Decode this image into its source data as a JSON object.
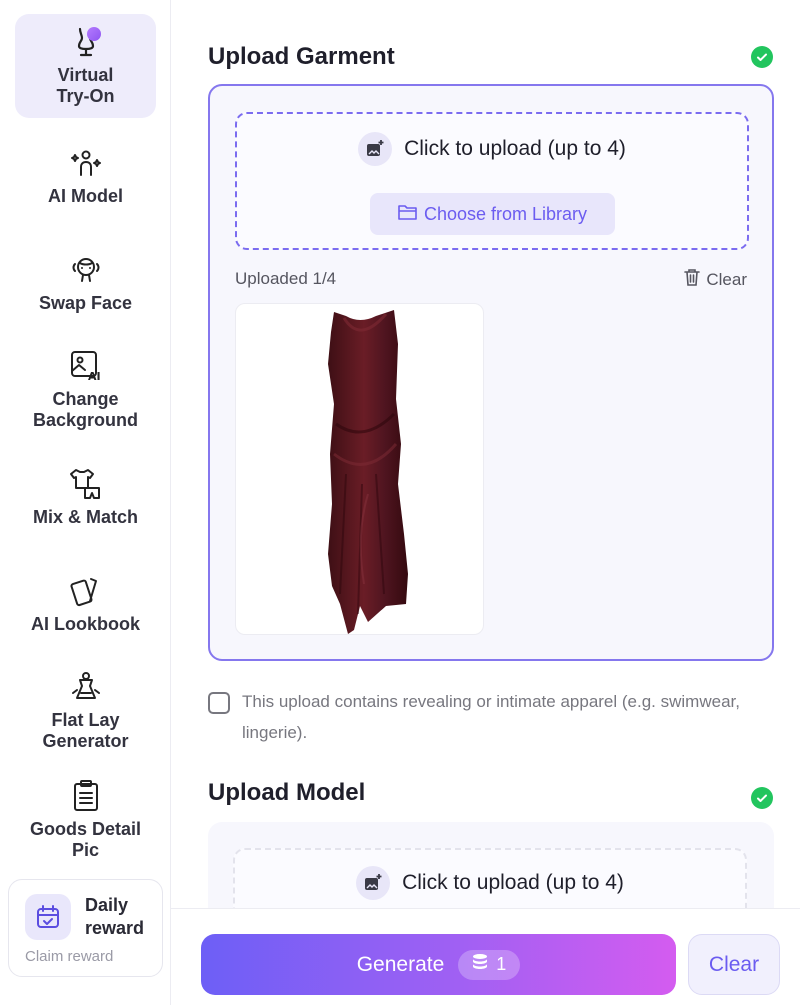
{
  "sidebar": {
    "items": [
      {
        "label_line1": "Virtual",
        "label_line2": "Try-On",
        "icon": "mannequin-icon",
        "active": true
      },
      {
        "label_line1": "AI Model",
        "icon": "ai-person-icon"
      },
      {
        "label_line1": "Swap Face",
        "icon": "face-swap-icon"
      },
      {
        "label_line1": "Change",
        "label_line2": "Background",
        "icon": "ai-image-icon"
      },
      {
        "label_line1": "Mix & Match",
        "icon": "clothes-icon"
      },
      {
        "label_line1": "AI Lookbook",
        "icon": "cards-icon"
      },
      {
        "label_line1": "Flat Lay",
        "label_line2": "Generator",
        "icon": "flat-lay-icon"
      },
      {
        "label_line1": "Goods Detail",
        "label_line2": "Pic",
        "icon": "clipboard-icon"
      }
    ],
    "reward": {
      "title_line1": "Daily",
      "title_line2": "reward",
      "subtitle": "Claim reward",
      "icon": "calendar-check-icon"
    }
  },
  "garment": {
    "title": "Upload Garment",
    "upload_text": "Click to upload (up to 4)",
    "library_button": "Choose from Library",
    "uploaded_count": "Uploaded 1/4",
    "clear_label": "Clear",
    "consent_text": "This upload contains revealing or intimate apparel (e.g. swimwear, lingerie).",
    "thumbnail": "burgundy-satin-dress"
  },
  "model": {
    "title": "Upload Model",
    "upload_text": "Click to upload (up to 4)"
  },
  "actions": {
    "generate_label": "Generate",
    "credit_cost": "1",
    "clear_label": "Clear"
  },
  "colors": {
    "accent": "#6b5cf0",
    "success": "#22c55e",
    "gradient_start": "#6d5ff6",
    "gradient_end": "#d45cf0"
  }
}
